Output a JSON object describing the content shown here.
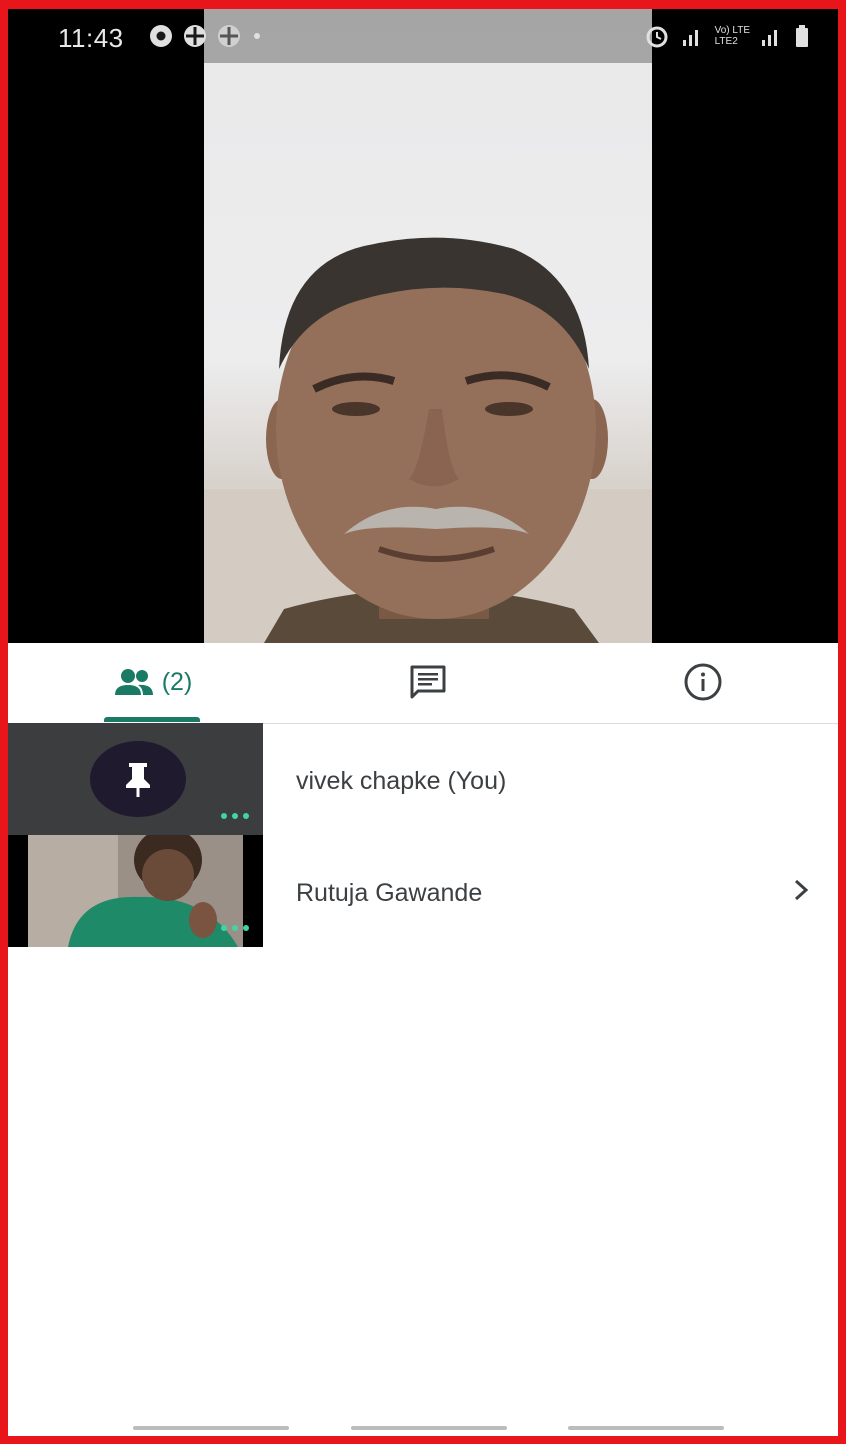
{
  "status_bar": {
    "time": "11:43",
    "left_icons": [
      "chrome-icon",
      "app-icon",
      "app-icon",
      "dot-icon"
    ],
    "right_icons": [
      "alarm-icon",
      "signal-icon",
      "volte-lte-icon",
      "signal-icon",
      "battery-icon"
    ],
    "network_label_top": "Vo) LTE",
    "network_label_bottom": "LTE2"
  },
  "video": {
    "main_participant_feed": "main-video"
  },
  "tabs": {
    "people_count": "(2)",
    "active": "people",
    "accent_color": "#1b7a66"
  },
  "participants": [
    {
      "name": "vivek chapke (You)",
      "has_pin": true,
      "has_chevron": false
    },
    {
      "name": "Rutuja Gawande",
      "has_pin": false,
      "has_chevron": true
    }
  ],
  "colors": {
    "frame_border": "#e8151b",
    "menu_dots": "#3fd6a6"
  }
}
